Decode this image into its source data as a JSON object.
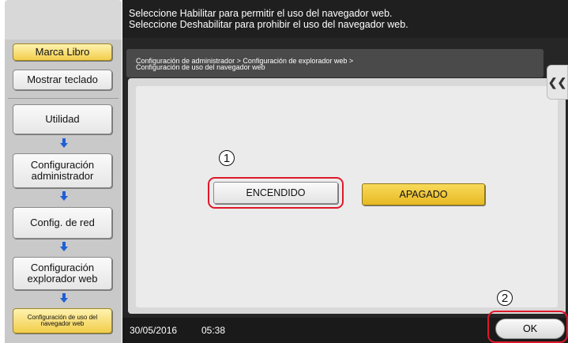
{
  "message": {
    "line1": "Seleccione Habilitar para permitir el uso del navegador web.",
    "line2": "Seleccione Deshabilitar para prohibir el uso del navegador web."
  },
  "breadcrumb": {
    "line1": "Configuración de administrador > Configuración de explorador web >",
    "line2": "Configuración de uso del navegador web"
  },
  "sidebar": {
    "marca_libro": "Marca Libro",
    "mostrar_teclado": "Mostrar teclado",
    "steps": [
      "Utilidad",
      "Configuración administrador",
      "Config. de red",
      "Configuración explorador web",
      "Configuración de uso del navegador web"
    ]
  },
  "options": {
    "on_label": "ENCENDIDO",
    "off_label": "APAGADO",
    "selected": "APAGADO"
  },
  "callouts": [
    "1",
    "2"
  ],
  "status": {
    "date": "30/05/2016",
    "time": "05:38"
  },
  "ok_label": "OK",
  "icons": {
    "collapse": "double-chevron-left-icon",
    "arrow": "arrow-down-icon"
  },
  "colors": {
    "accent_gold": "#f1cd4a",
    "highlight_red": "#e0182b",
    "arrow_blue": "#1f5fd6"
  }
}
